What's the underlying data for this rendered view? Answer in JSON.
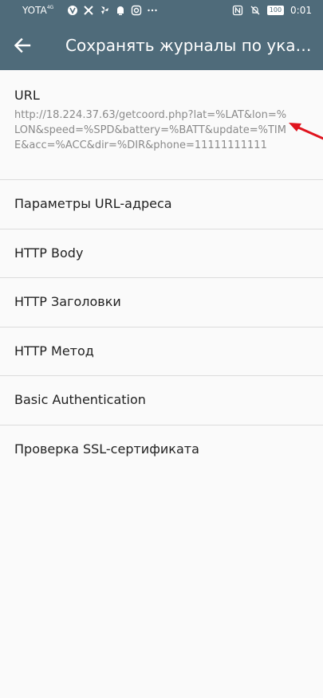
{
  "status_bar": {
    "carrier": "YOTA",
    "network": "4G",
    "battery": "100",
    "time": "0:01",
    "icons_left": [
      "v-icon",
      "tools-icon",
      "fan-icon",
      "alarm-icon",
      "instagram-icon",
      "more-dots-icon"
    ],
    "icons_right": [
      "nfc-icon",
      "mute-icon",
      "battery-icon"
    ]
  },
  "app_bar": {
    "title": "Сохранять журналы по указ...",
    "back_icon": "arrow-left-icon"
  },
  "settings": {
    "url": {
      "title": "URL",
      "value": "http://18.224.37.63/getcoord.php?lat=%LAT&lon=%LON&speed=%SPD&battery=%BATT&update=%TIME&acc=%ACC&dir=%DIR&phone=11111111111"
    },
    "items": [
      {
        "label": "Параметры URL-адреса"
      },
      {
        "label": "HTTP Body"
      },
      {
        "label": "HTTP Заголовки"
      },
      {
        "label": "HTTP Метод"
      },
      {
        "label": "Basic Authentication"
      },
      {
        "label": "Проверка SSL-сертификата"
      }
    ]
  },
  "colors": {
    "primary": "#4f6b7a",
    "background": "#fafafa",
    "divider": "#dcdcdc",
    "text_primary": "#212121",
    "text_secondary": "#8a8a8a",
    "annotation_arrow": "#e0141e"
  }
}
